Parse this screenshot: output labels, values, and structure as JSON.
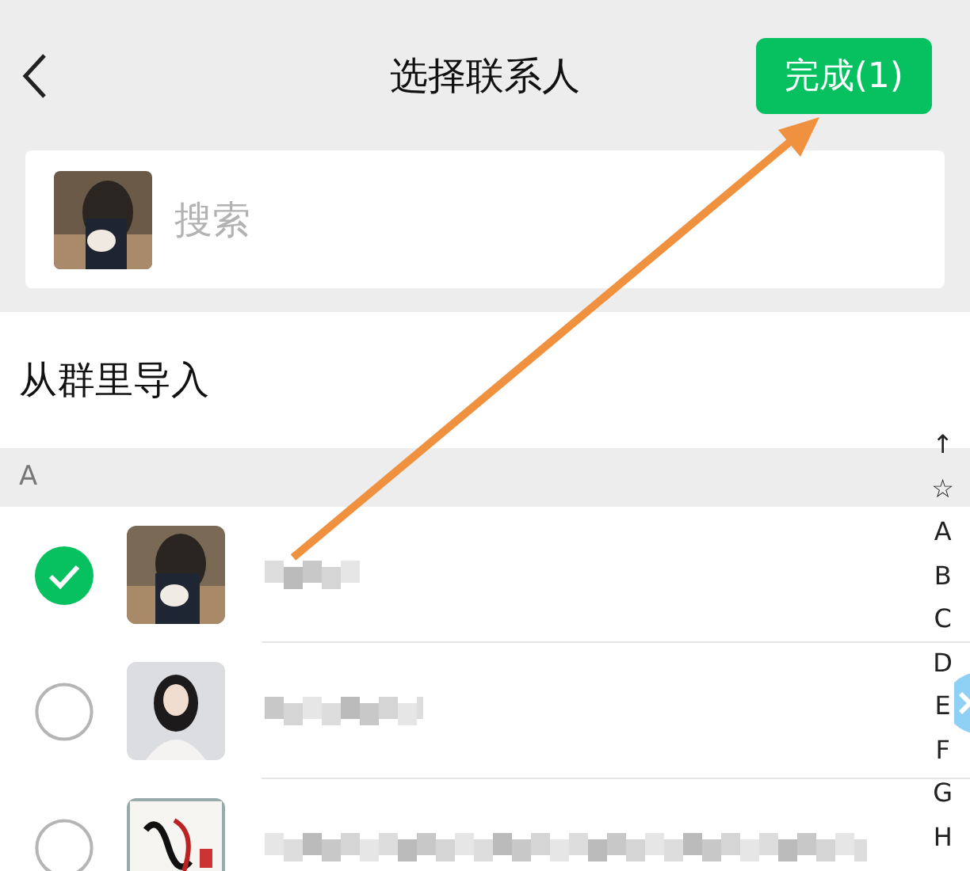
{
  "header": {
    "title": "选择联系人",
    "done_button": "完成(1)"
  },
  "search": {
    "placeholder": "搜索"
  },
  "import_label": "从群里导入",
  "section": {
    "label": "A"
  },
  "contacts": [
    {
      "selected": true
    },
    {
      "selected": false
    },
    {
      "selected": false
    }
  ],
  "index": [
    "↑",
    "☆",
    "A",
    "B",
    "C",
    "D",
    "E",
    "F",
    "G",
    "H"
  ]
}
